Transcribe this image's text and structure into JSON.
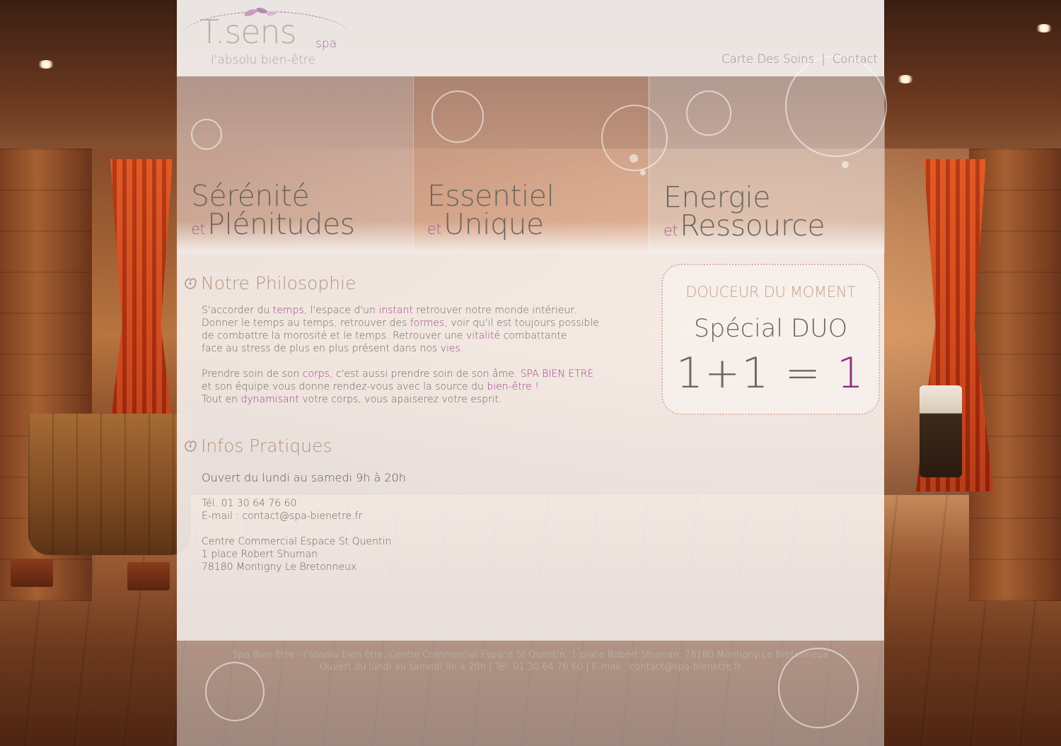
{
  "brand": {
    "logo_word": "T.sens",
    "logo_suffix": "spa",
    "logo_tagline": "l'absolu bien-être"
  },
  "nav": {
    "items": [
      "Carte Des Soins",
      "Contact"
    ],
    "separator": "|"
  },
  "hero": {
    "taglines": [
      {
        "line1": "Sérénité",
        "et": "et",
        "line2": "Plénitudes"
      },
      {
        "line1": "Essentiel",
        "et": "et",
        "line2": "Unique"
      },
      {
        "line1": "Energie",
        "et": "et",
        "line2": "Ressource"
      }
    ]
  },
  "philosophy": {
    "title": "Notre Philosophie",
    "p1": {
      "t1": "S'accorder du ",
      "h1": "temps",
      "t2": ",  l'espace d'un ",
      "h2": "instant",
      "t3": " retrouver notre monde intérieur.",
      "t4": "Donner le temps au temps, retrouver des ",
      "h3": "formes",
      "t5": ", voir qu'il est toujours possible",
      "t6": "de combattre la morosité et le temps. Retrouver une ",
      "h4": "vitalité",
      "t7": " combattante",
      "t8": "face au stress de plus en plus présent dans nos ",
      "h5": "vies",
      "t9": "."
    },
    "p2": {
      "t1": "Prendre soin de son ",
      "h1": "corps",
      "t2": ", c'est aussi prendre soin de son âme. ",
      "h2": "SPA BIEN ETRE",
      "t3": "et son équipe vous donne rendez-vous avec la source du ",
      "h3": "bien-être !",
      "t4": "Tout en ",
      "h4": "dynamisant",
      "t5": " votre corps, vous apaiserez votre esprit."
    }
  },
  "infos": {
    "title": "Infos Pratiques",
    "hours": "Ouvert du lundi au samedi 9h à 20h",
    "phone": "Tél. 01 30 64 76 60",
    "email": "E-mail : contact@spa-bienetre.fr",
    "address_lines": [
      "Centre Commercial Espace St Quentin",
      "1 place Robert Shuman",
      "78180 Montigny Le Bretonneux"
    ]
  },
  "promo": {
    "heading": "DOUCEUR DU MOMENT",
    "title": "Spécial DUO",
    "equation": "1+1 =",
    "result": "1"
  },
  "footer": {
    "line1": "Spa Bien Etre - l'absolu bien être, Centre Commercial Espace St Quentin, 1 place Robert Shuman, 78180 Montigny Le Bretonneux",
    "line2": "Ouvert du lundi au samedi 9h à 20h  |  Tél. 01 30 64 76 60  |  E-mail : contact@spa-bienetre.fr"
  },
  "colors": {
    "accent": "#a0418e",
    "text": "#6f6660",
    "section_title": "#b59480",
    "promo_border": "#d8b4a4"
  }
}
